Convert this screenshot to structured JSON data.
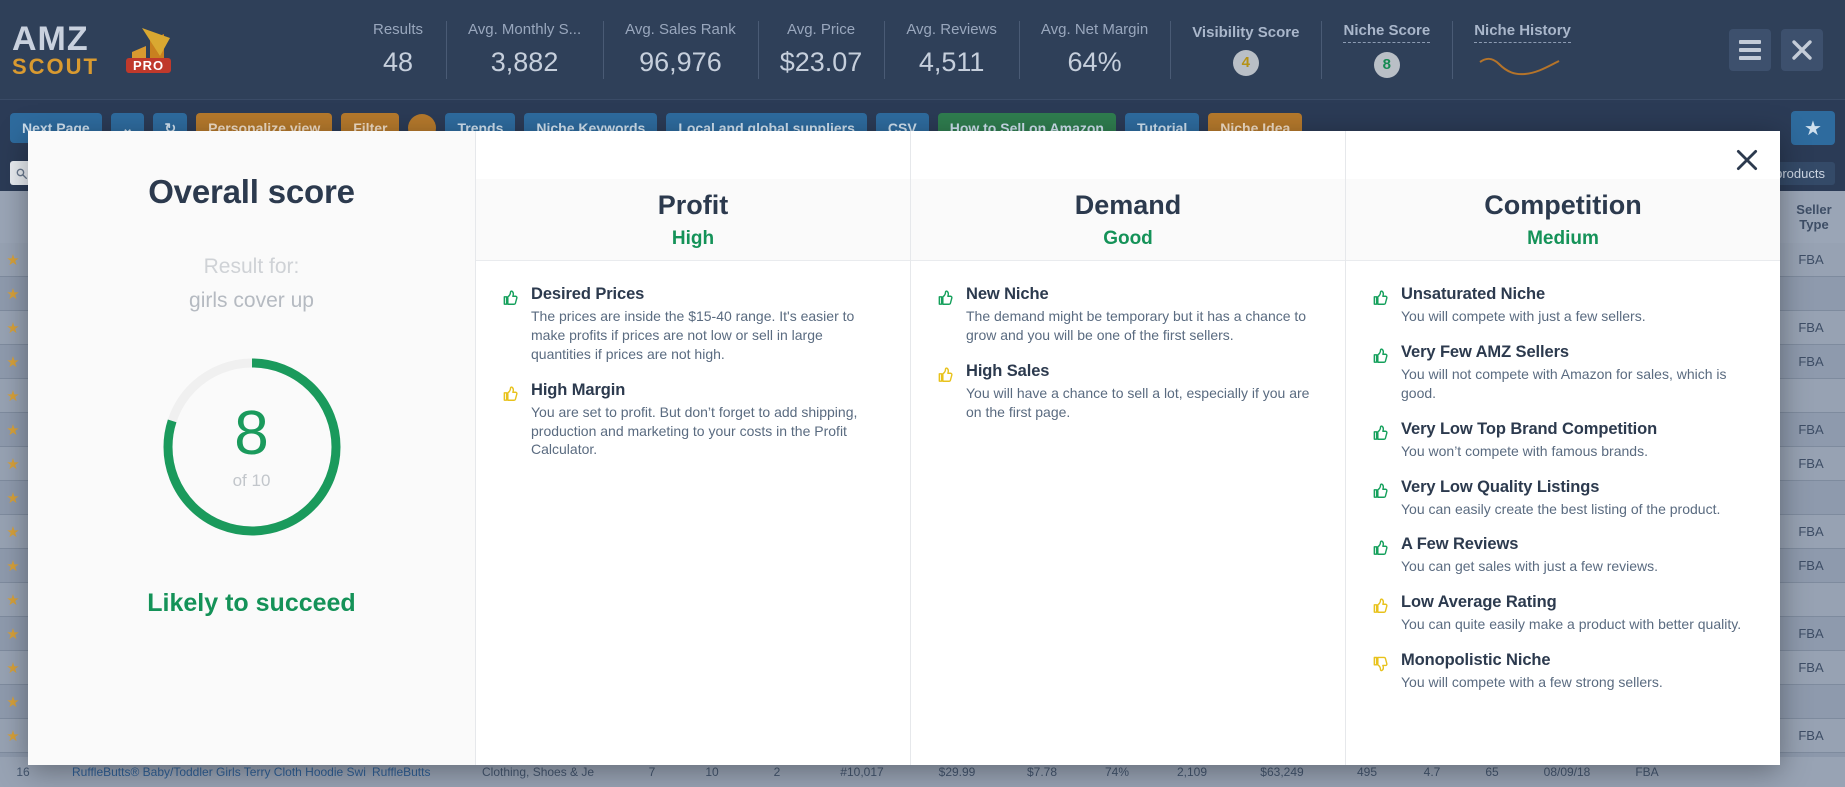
{
  "brand": {
    "name_top": "AMZ",
    "name_bottom": "SCOUT",
    "badge": "PRO"
  },
  "topbar": {
    "stats": [
      {
        "label": "Results",
        "value": "48",
        "kind": "text"
      },
      {
        "label": "Avg. Monthly S...",
        "value": "3,882",
        "kind": "text"
      },
      {
        "label": "Avg. Sales Rank",
        "value": "96,976",
        "kind": "text"
      },
      {
        "label": "Avg. Price",
        "value": "$23.07",
        "kind": "text"
      },
      {
        "label": "Avg. Reviews",
        "value": "4,511",
        "kind": "text"
      },
      {
        "label": "Avg. Net Margin",
        "value": "64%",
        "kind": "text"
      },
      {
        "label": "Visibility Score",
        "value": "4",
        "kind": "pill-yellow"
      },
      {
        "label": "Niche Score",
        "value": "8",
        "kind": "pill-green"
      },
      {
        "label": "Niche History",
        "value": "",
        "kind": "sparkline"
      }
    ],
    "menu_icon": "hamburger-menu-icon",
    "close_icon": "close-icon"
  },
  "subbar": {
    "buttons": [
      {
        "label": "Next Page",
        "style": "blue"
      },
      {
        "label": "⌄",
        "style": "blue"
      },
      {
        "label": "↻",
        "style": "blue"
      },
      {
        "label": "Personalize view",
        "style": "orange"
      },
      {
        "label": "Filter",
        "style": "orange"
      },
      {
        "label": "Trends",
        "style": "blue"
      },
      {
        "label": "Niche Keywords",
        "style": "blue"
      },
      {
        "label": "Local and global suppliers",
        "style": "blue"
      },
      {
        "label": "CSV",
        "style": "blue"
      },
      {
        "label": "How to Sell on Amazon",
        "style": "green"
      },
      {
        "label": "Tutorial",
        "style": "blue"
      },
      {
        "label": "Niche Idea",
        "style": "orange"
      }
    ],
    "star_label": "★"
  },
  "bg_table": {
    "search_placeholder": "Search",
    "chip": "products",
    "seller_type_header_line1": "Seller",
    "seller_type_header_line2": "Type",
    "fba_label": "FBA",
    "last_row": {
      "index": "16",
      "title": "RuffleButts® Baby/Toddler Girls Terry Cloth Hoodie Swi",
      "brand": "RuffleButts",
      "category": "Clothing, Shoes & Je",
      "v1": "7",
      "v2": "10",
      "v3": "2",
      "rank": "#10,017",
      "price": "$29.99",
      "fees": "$7.78",
      "margin": "74%",
      "sales": "2,109",
      "revenue": "$63,249",
      "reviews": "495",
      "rating": "4.7",
      "sellers": "65",
      "date": "08/09/18",
      "seller_type": "FBA"
    }
  },
  "modal": {
    "close_icon": "close-icon",
    "score_panel": {
      "title": "Overall score",
      "result_for_label": "Result for:",
      "keyword": "girls cover up",
      "score": "8",
      "score_of": "of 10",
      "score_max": 10,
      "verdict": "Likely to succeed",
      "ring_color": "#1a9a5c",
      "ring_track_color": "#f0f0f0"
    },
    "columns": [
      {
        "title": "Profit",
        "verdict": "High",
        "verdict_color": "#149258",
        "items": [
          {
            "icon": "thumbs-up-icon",
            "icon_color": "#15a05c",
            "title": "Desired Prices",
            "desc": "The prices are inside the $15-40 range. It's easier to make profits if prices are not low or sell in large quantities if prices are not high."
          },
          {
            "icon": "thumbs-up-icon",
            "icon_color": "#e8c21c",
            "title": "High Margin",
            "desc": "You are set to profit. But don’t forget to add shipping, production and marketing to your costs in the Profit Calculator."
          }
        ]
      },
      {
        "title": "Demand",
        "verdict": "Good",
        "verdict_color": "#149258",
        "items": [
          {
            "icon": "thumbs-up-icon",
            "icon_color": "#15a05c",
            "title": "New Niche",
            "desc": "The demand might be temporary but it has a chance to grow and you will be one of the first sellers."
          },
          {
            "icon": "thumbs-up-icon",
            "icon_color": "#e8c21c",
            "title": "High Sales",
            "desc": "You will have a chance to sell a lot, especially if you are on the first page."
          }
        ]
      },
      {
        "title": "Competition",
        "verdict": "Medium",
        "verdict_color": "#149258",
        "items": [
          {
            "icon": "thumbs-up-icon",
            "icon_color": "#15a05c",
            "title": "Unsaturated Niche",
            "desc": "You will compete with just a few sellers."
          },
          {
            "icon": "thumbs-up-icon",
            "icon_color": "#15a05c",
            "title": "Very Few AMZ Sellers",
            "desc": "You will not compete with Amazon for sales, which is good."
          },
          {
            "icon": "thumbs-up-icon",
            "icon_color": "#15a05c",
            "title": "Very Low Top Brand Competition",
            "desc": "You won’t compete with famous brands."
          },
          {
            "icon": "thumbs-up-icon",
            "icon_color": "#15a05c",
            "title": "Very Low Quality Listings",
            "desc": "You can easily create the best listing of the product."
          },
          {
            "icon": "thumbs-up-icon",
            "icon_color": "#15a05c",
            "title": "A Few Reviews",
            "desc": "You can get sales with just a few reviews."
          },
          {
            "icon": "thumbs-up-icon",
            "icon_color": "#e8c21c",
            "title": "Low Average Rating",
            "desc": "You can quite easily make a product with better quality."
          },
          {
            "icon": "thumbs-down-icon",
            "icon_color": "#e8c21c",
            "title": "Monopolistic Niche",
            "desc": "You will compete with a few strong sellers."
          }
        ]
      }
    ]
  }
}
